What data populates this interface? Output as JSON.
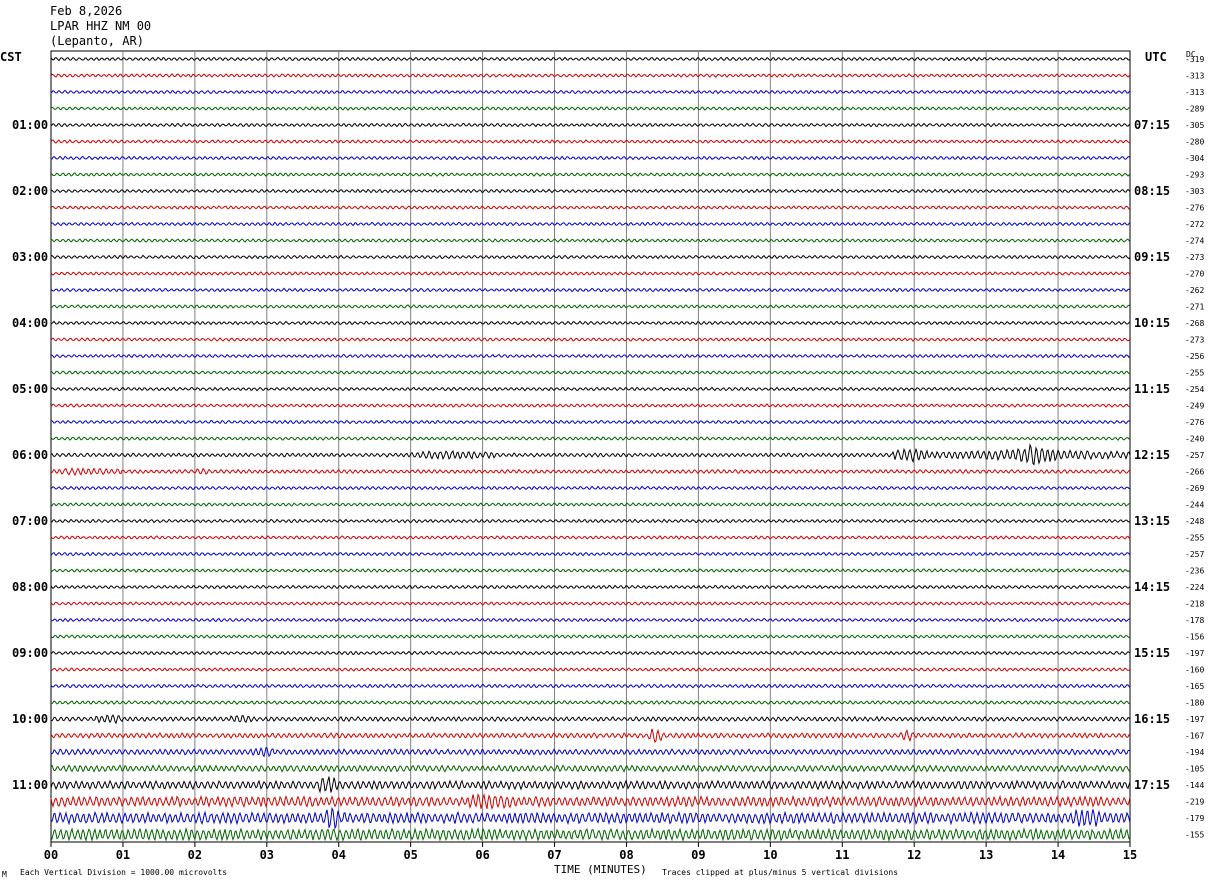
{
  "header": {
    "date": "Feb 8,2026",
    "station": "LPAR HHZ NM 00",
    "location": "(Lepanto, AR)"
  },
  "left_zone_label": "CST",
  "right_zone_label": "UTC",
  "dc_label": "DC",
  "footer": {
    "corner_mark": "M",
    "division_note": "Each Vertical Division = 1000.00 microvolts",
    "xlabel": "TIME (MINUTES)",
    "clip_note": "Traces clipped at plus/minus 5 vertical divisions"
  },
  "colors": {
    "trace_cycle": [
      "#000000",
      "#d40000",
      "#0000cc",
      "#006400"
    ],
    "grid": "#808080"
  },
  "chart_data": {
    "type": "line",
    "title": "LPAR HHZ NM 00",
    "xlabel": "TIME (MINUTES)",
    "xlim": [
      0,
      15
    ],
    "x_ticks": [
      "00",
      "01",
      "02",
      "03",
      "04",
      "05",
      "06",
      "07",
      "08",
      "09",
      "10",
      "11",
      "12",
      "13",
      "14",
      "15"
    ],
    "row_count": 48,
    "left_hour_labels": [
      "01:00",
      "02:00",
      "03:00",
      "04:00",
      "05:00",
      "06:00",
      "07:00",
      "08:00",
      "09:00",
      "10:00",
      "11:00"
    ],
    "right_hour_labels": [
      "07:15",
      "08:15",
      "09:15",
      "10:15",
      "11:15",
      "12:15",
      "13:15",
      "14:15",
      "15:15",
      "16:15",
      "17:15"
    ],
    "dc_offsets": [
      "-319",
      "-313",
      "-313",
      "-289",
      "-305",
      "-280",
      "-304",
      "-293",
      "-303",
      "-276",
      "-272",
      "-274",
      "-273",
      "-270",
      "-262",
      "-271",
      "-268",
      "-273",
      "-256",
      "-255",
      "-254",
      "-249",
      "-276",
      "-240",
      "-257",
      "-266",
      "-269",
      "-244",
      "-248",
      "-255",
      "-257",
      "-236",
      "-224",
      "-218",
      "-178",
      "-156",
      "-197",
      "-160",
      "-165",
      "-180",
      "-197",
      "-167",
      "-194",
      "-105",
      "-144",
      "-219",
      "-179",
      "-155"
    ],
    "row_amplitude": [
      1,
      1,
      1,
      1,
      1,
      1,
      1,
      1,
      1,
      1,
      1,
      1,
      1,
      1,
      1,
      1,
      1,
      1,
      1,
      1,
      1,
      1,
      1,
      1,
      1.2,
      1.2,
      1,
      1,
      1,
      1,
      1,
      1,
      1,
      1,
      1,
      1,
      1,
      1,
      1.1,
      1.1,
      1.4,
      1.6,
      1.8,
      2,
      2.6,
      3.2,
      3.6,
      3.6
    ],
    "events": [
      {
        "row": 24,
        "start_min": 5.0,
        "end_min": 6.2,
        "peak": 3
      },
      {
        "row": 24,
        "start_min": 11.7,
        "end_min": 12.2,
        "peak": 6
      },
      {
        "row": 24,
        "start_min": 12.2,
        "end_min": 15.0,
        "peak": 4
      },
      {
        "row": 24,
        "start_min": 13.3,
        "end_min": 14.0,
        "peak": 9
      },
      {
        "row": 25,
        "start_min": 0.0,
        "end_min": 1.0,
        "peak": 2
      },
      {
        "row": 25,
        "start_min": 2.0,
        "end_min": 2.2,
        "peak": 2
      },
      {
        "row": 40,
        "start_min": 0.6,
        "end_min": 1.0,
        "peak": 3
      },
      {
        "row": 40,
        "start_min": 2.5,
        "end_min": 2.8,
        "peak": 3
      },
      {
        "row": 41,
        "start_min": 8.3,
        "end_min": 8.5,
        "peak": 7
      },
      {
        "row": 41,
        "start_min": 11.8,
        "end_min": 12.0,
        "peak": 4
      },
      {
        "row": 42,
        "start_min": 2.8,
        "end_min": 3.1,
        "peak": 3
      },
      {
        "row": 44,
        "start_min": 3.7,
        "end_min": 4.0,
        "peak": 6
      },
      {
        "row": 45,
        "start_min": 5.8,
        "end_min": 6.4,
        "peak": 4
      },
      {
        "row": 46,
        "start_min": 3.8,
        "end_min": 4.0,
        "peak": 8
      },
      {
        "row": 46,
        "start_min": 14.2,
        "end_min": 14.6,
        "peak": 5
      }
    ]
  }
}
